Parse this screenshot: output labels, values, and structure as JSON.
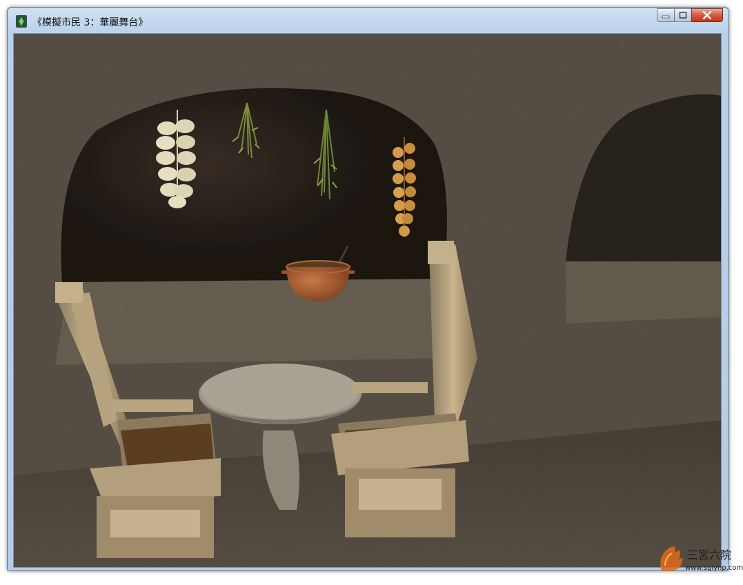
{
  "window": {
    "title": "《模擬市民 3：華麗舞台》",
    "icon": "sims-plumbob-icon",
    "controls": {
      "minimize": "minimize-icon",
      "maximize": "maximize-icon",
      "close": "close-icon"
    }
  },
  "scene": {
    "description_icons": [
      "garlic-braid",
      "dried-herbs",
      "onion-braid",
      "clay-pot",
      "stone-table",
      "stone-chair"
    ]
  },
  "watermark": {
    "site": "www.sgiynp.com",
    "logo": "sgiynp-watermark-logo"
  },
  "colors": {
    "titlebar": "#b9d1ea",
    "close_button": "#c3371b",
    "rock": "#5a5247",
    "cave_dark": "#2a241d"
  }
}
